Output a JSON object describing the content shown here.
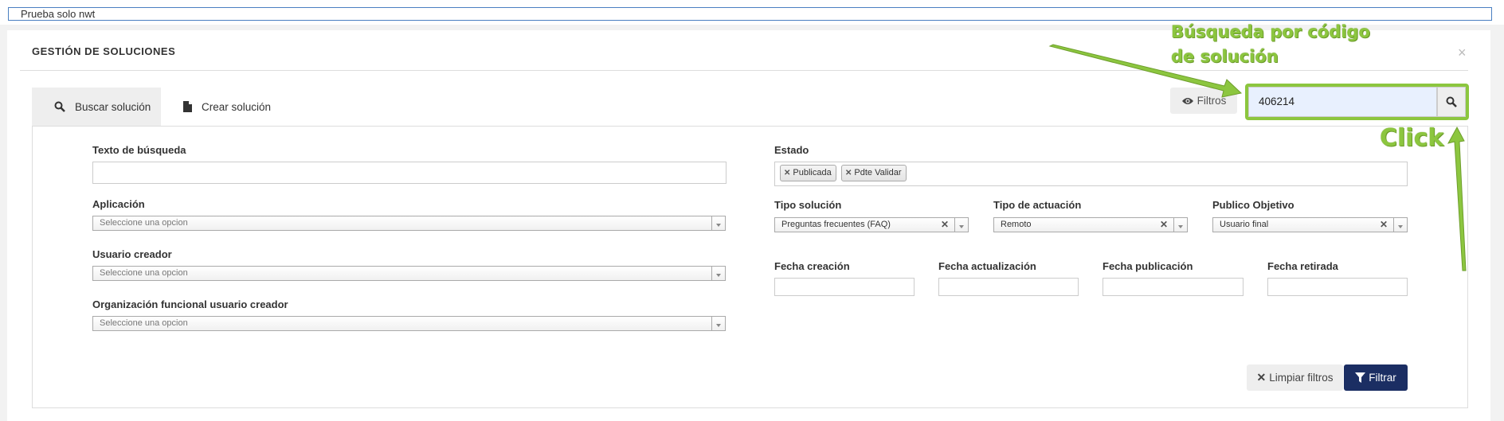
{
  "topbar": {
    "text": "Prueba solo nwt"
  },
  "modal": {
    "title": "GESTIÓN DE SOLUCIONES",
    "close": "×"
  },
  "tabs": [
    {
      "label": "Buscar solución",
      "icon": "search-icon"
    },
    {
      "label": "Crear solución",
      "icon": "file-icon"
    }
  ],
  "toolbar": {
    "filtros_label": "Filtros",
    "search_value": "406214"
  },
  "form": {
    "texto_busqueda": {
      "label": "Texto de búsqueda",
      "value": ""
    },
    "aplicacion": {
      "label": "Aplicación",
      "placeholder": "Seleccione una opcion"
    },
    "usuario_creador": {
      "label": "Usuario creador",
      "placeholder": "Seleccione una opcion"
    },
    "org_funcional": {
      "label": "Organización funcional usuario creador",
      "placeholder": "Seleccione una opcion"
    },
    "estado": {
      "label": "Estado",
      "tags": [
        "Publicada",
        "Pdte Validar"
      ]
    },
    "tipo_solucion": {
      "label": "Tipo solución",
      "value": "Preguntas frecuentes (FAQ)"
    },
    "tipo_actuacion": {
      "label": "Tipo de actuación",
      "value": "Remoto"
    },
    "publico_objetivo": {
      "label": "Publico Objetivo",
      "value": "Usuario final"
    },
    "fecha_creacion": {
      "label": "Fecha creación"
    },
    "fecha_actualizacion": {
      "label": "Fecha actualización"
    },
    "fecha_publicacion": {
      "label": "Fecha publicación"
    },
    "fecha_retirada": {
      "label": "Fecha retirada"
    }
  },
  "buttons": {
    "limpiar": "Limpiar filtros",
    "filtrar": "Filtrar"
  },
  "annotations": {
    "line1": "Búsqueda por código",
    "line2": "de solución",
    "click": "Click"
  },
  "colors": {
    "accent": "#8cc63f",
    "primary_button": "#1b2e63",
    "topbar_border": "#4a7fc1"
  }
}
